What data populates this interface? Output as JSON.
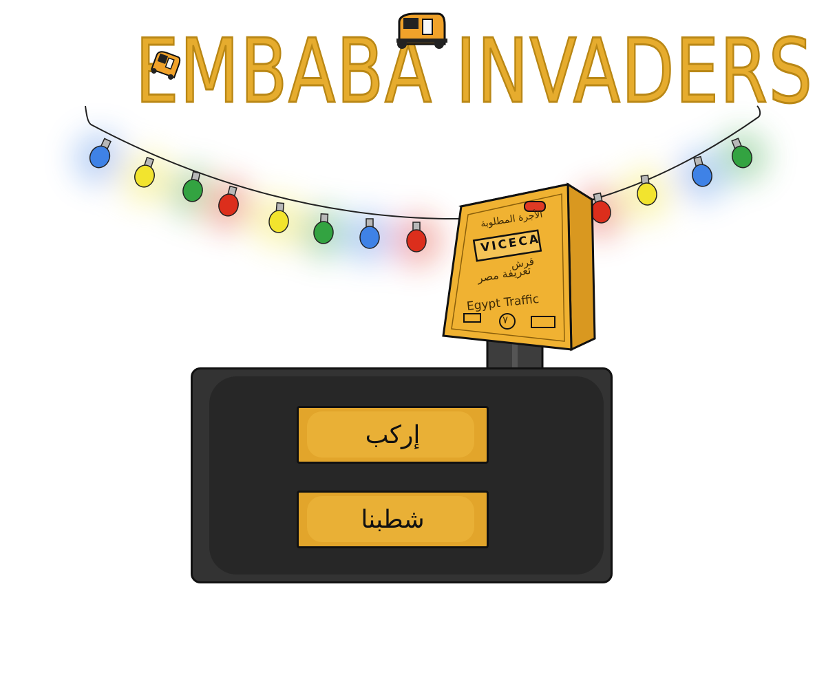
{
  "title": "EMBABA INVADERS",
  "menu": {
    "ride_label": "إركب",
    "stats_label": "شطبنا"
  },
  "fare_meter": {
    "header": "الأجرة المطلوبة",
    "display": "VICECA",
    "unit": "قرش",
    "tariff": "تعريفة مصر",
    "brand": "Egypt Traffic",
    "number": "٧"
  },
  "colors": {
    "title": "#e6ac2e",
    "button": "#e2a52b",
    "panel": "#272727",
    "meter": "#f0b232",
    "bulb_blue": "#3f82e6",
    "bulb_yellow": "#f2e42e",
    "bulb_green": "#33a341",
    "bulb_red": "#dc2e1c"
  },
  "icons": {
    "tuktuk": "tuktuk-icon",
    "bulb": "light-bulb-icon"
  }
}
